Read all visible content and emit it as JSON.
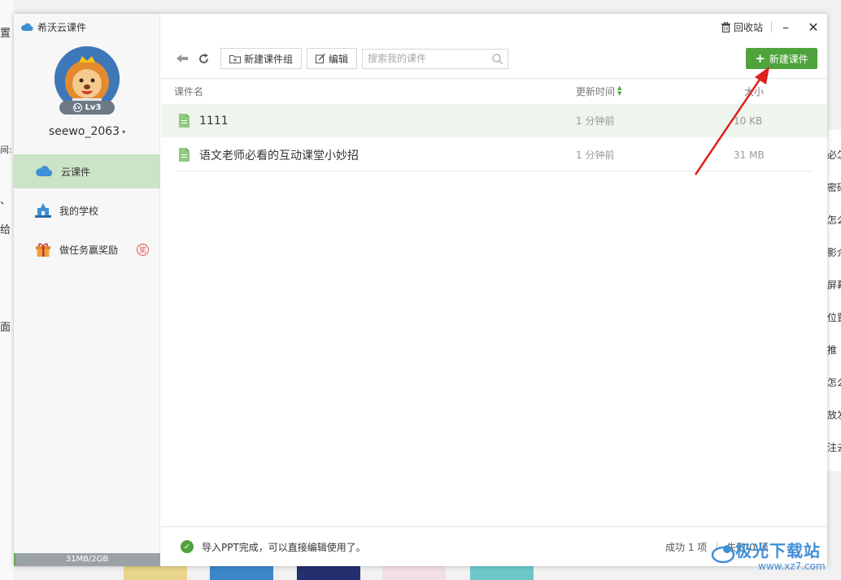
{
  "background": {
    "left_chars": [
      "置",
      "间:",
      "、",
      "给",
      "面"
    ],
    "right_chars": [
      "必怎",
      "密码",
      "怎么",
      "影介",
      "屏幕",
      "位置",
      "推",
      "怎么",
      "放发",
      "注去"
    ]
  },
  "app": {
    "title": "希沃云课件",
    "icons": {
      "cloud": "cloud-icon"
    },
    "colors": {
      "accent": "#4ea33d",
      "nav_active": "#cbe3c6"
    }
  },
  "user": {
    "name": "seewo_2063",
    "level": "Lv3"
  },
  "sidebar": {
    "items": [
      {
        "label": "云课件",
        "icon": "cloud-icon",
        "active": true
      },
      {
        "label": "我的学校",
        "icon": "school-icon",
        "active": false
      },
      {
        "label": "做任务赢奖励",
        "icon": "gift-icon",
        "active": false,
        "badge": "奖"
      }
    ],
    "storage": {
      "text": "31MB/2GB",
      "used_fraction": 0.015
    }
  },
  "window_controls": {
    "recycle_label": "回收站",
    "minimize": "–",
    "close": "✕"
  },
  "toolbar": {
    "back_icon": "back-arrow-icon",
    "refresh_icon": "refresh-icon",
    "new_group_label": "新建课件组",
    "edit_label": "编辑",
    "search_placeholder": "搜索我的课件",
    "new_courseware_label": "新建课件"
  },
  "table": {
    "headers": {
      "name": "课件名",
      "time": "更新时间",
      "size": "大小"
    },
    "rows": [
      {
        "name": "1111",
        "time": "1 分钟前",
        "size": "10 KB",
        "selected": true
      },
      {
        "name": "语文老师必看的互动课堂小妙招",
        "time": "1 分钟前",
        "size": "31 MB",
        "selected": false
      }
    ]
  },
  "footer": {
    "message": "导入PPT完成，可以直接编辑使用了。",
    "success": "成功 1 项",
    "failed": "失败 0 项"
  },
  "watermark": {
    "title": "极光下载站",
    "url": "www.xz7.com"
  }
}
